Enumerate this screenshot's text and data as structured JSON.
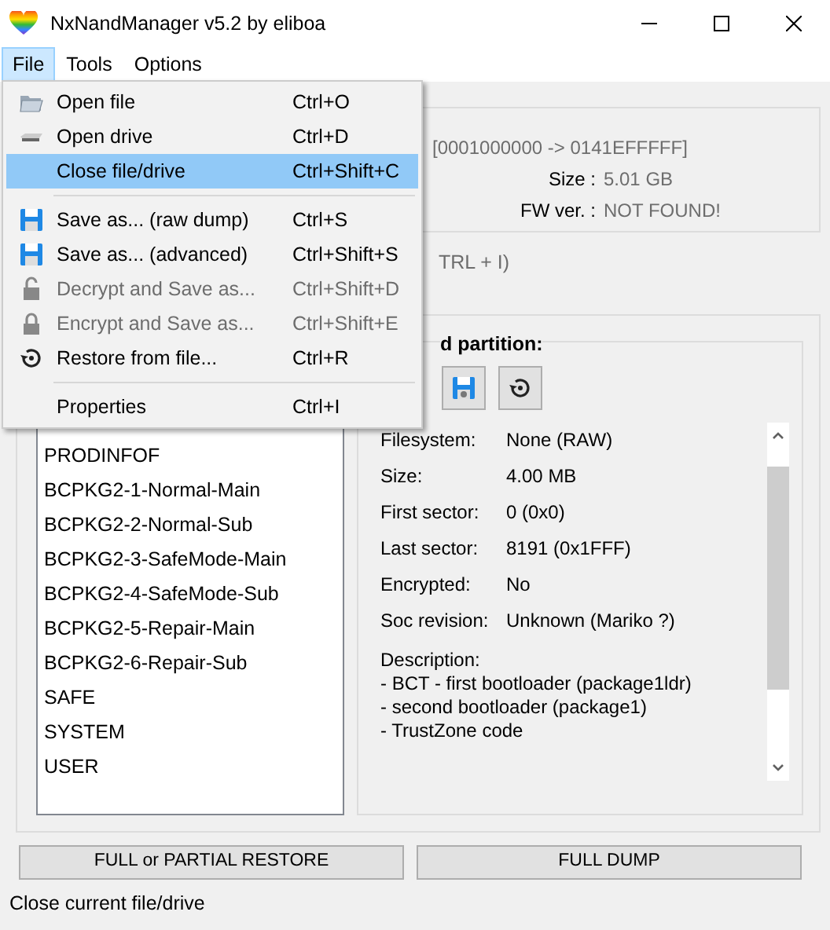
{
  "window": {
    "title": "NxNandManager v5.2 by eliboa"
  },
  "menu_bar": [
    {
      "label": "File",
      "selected": true
    },
    {
      "label": "Tools",
      "selected": false
    },
    {
      "label": "Options",
      "selected": false
    }
  ],
  "file_menu": [
    {
      "kind": "item",
      "label": "Open file",
      "shortcut": "Ctrl+O",
      "disabled": false,
      "selected": false
    },
    {
      "kind": "item",
      "label": "Open drive",
      "shortcut": "Ctrl+D",
      "disabled": false,
      "selected": false
    },
    {
      "kind": "item",
      "label": "Close file/drive",
      "shortcut": "Ctrl+Shift+C",
      "disabled": false,
      "selected": true
    },
    {
      "kind": "separator"
    },
    {
      "kind": "item",
      "label": "Save as... (raw dump)",
      "shortcut": "Ctrl+S",
      "disabled": false,
      "selected": false
    },
    {
      "kind": "item",
      "label": "Save as... (advanced)",
      "shortcut": "Ctrl+Shift+S",
      "disabled": false,
      "selected": false
    },
    {
      "kind": "item",
      "label": "Decrypt and Save as...",
      "shortcut": "Ctrl+Shift+D",
      "disabled": true,
      "selected": false
    },
    {
      "kind": "item",
      "label": "Encrypt and Save as...",
      "shortcut": "Ctrl+Shift+E",
      "disabled": true,
      "selected": false
    },
    {
      "kind": "item",
      "label": "Restore from file...",
      "shortcut": "Ctrl+R",
      "disabled": false,
      "selected": false
    },
    {
      "kind": "separator"
    },
    {
      "kind": "item",
      "label": "Properties",
      "shortcut": "Ctrl+I",
      "disabled": false,
      "selected": false
    }
  ],
  "info": {
    "range": "[0001000000 -> 0141EFFFFF]",
    "fields": [
      {
        "label": "Size :",
        "value": "5.01 GB"
      },
      {
        "label": "FW ver. :",
        "value": "NOT FOUND!"
      }
    ]
  },
  "hint": "TRL + I)",
  "partitions": [
    {
      "name": "PRODINFOF",
      "selected": false
    },
    {
      "name": "BCPKG2-1-Normal-Main",
      "selected": false
    },
    {
      "name": "BCPKG2-2-Normal-Sub",
      "selected": false
    },
    {
      "name": "BCPKG2-3-SafeMode-Main",
      "selected": false
    },
    {
      "name": "BCPKG2-4-SafeMode-Sub",
      "selected": false
    },
    {
      "name": "BCPKG2-5-Repair-Main",
      "selected": false
    },
    {
      "name": "BCPKG2-6-Repair-Sub",
      "selected": false
    },
    {
      "name": "SAFE",
      "selected": false
    },
    {
      "name": "SYSTEM",
      "selected": false
    },
    {
      "name": "USER",
      "selected": false
    }
  ],
  "partition_panel": {
    "title": "d partition:",
    "details": [
      {
        "label": "Filesystem:",
        "value": "None (RAW)"
      },
      {
        "label": "Size:",
        "value": "4.00 MB"
      },
      {
        "label": "First sector:",
        "value": "0 (0x0)"
      },
      {
        "label": "Last sector:",
        "value": "8191 (0x1FFF)"
      },
      {
        "label": "Encrypted:",
        "value": "No"
      },
      {
        "label": "Soc revision:",
        "value": "Unknown (Mariko ?)"
      }
    ],
    "description": [
      "Description:",
      "- BCT - first bootloader (package1ldr)",
      "- second bootloader (package1)",
      "- TrustZone code"
    ]
  },
  "buttons": [
    "FULL or PARTIAL RESTORE",
    "FULL DUMP"
  ],
  "status_bar": "Close current file/drive"
}
